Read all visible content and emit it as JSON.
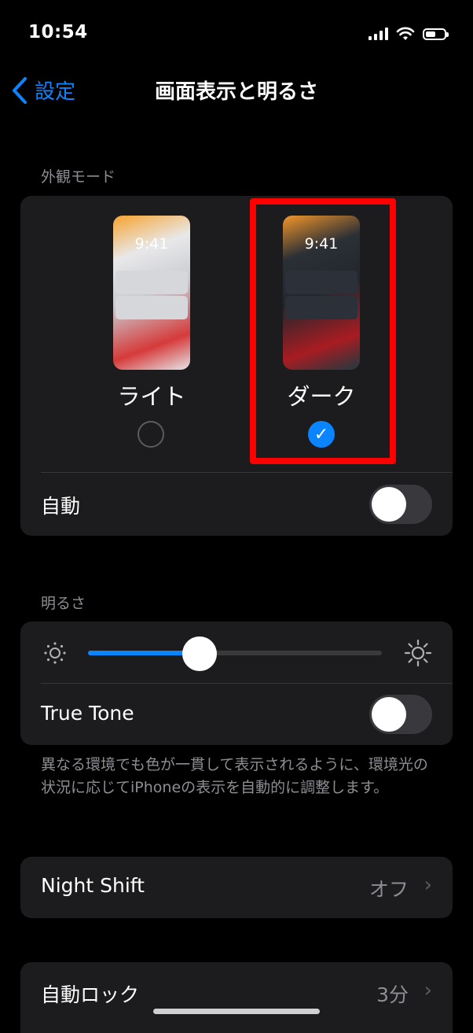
{
  "status": {
    "time": "10:54"
  },
  "nav": {
    "back_label": "設定",
    "title": "画面表示と明るさ"
  },
  "appearance": {
    "header": "外観モード",
    "light": {
      "label": "ライト",
      "preview_time": "9:41",
      "selected": false
    },
    "dark": {
      "label": "ダーク",
      "preview_time": "9:41",
      "selected": true
    },
    "auto_label": "自動",
    "auto_on": false
  },
  "brightness": {
    "header": "明るさ",
    "level": 0.38,
    "true_tone_label": "True Tone",
    "true_tone_on": false,
    "footnote": "異なる環境でも色が一貫して表示されるように、環境光の状況に応じてiPhoneの表示を自動的に調整します。"
  },
  "night_shift": {
    "label": "Night Shift",
    "value": "オフ"
  },
  "auto_lock": {
    "label": "自動ロック",
    "value": "3分"
  },
  "colors": {
    "accent": "#0a84ff",
    "highlight": "#ff0000",
    "card": "#1c1c1e"
  }
}
